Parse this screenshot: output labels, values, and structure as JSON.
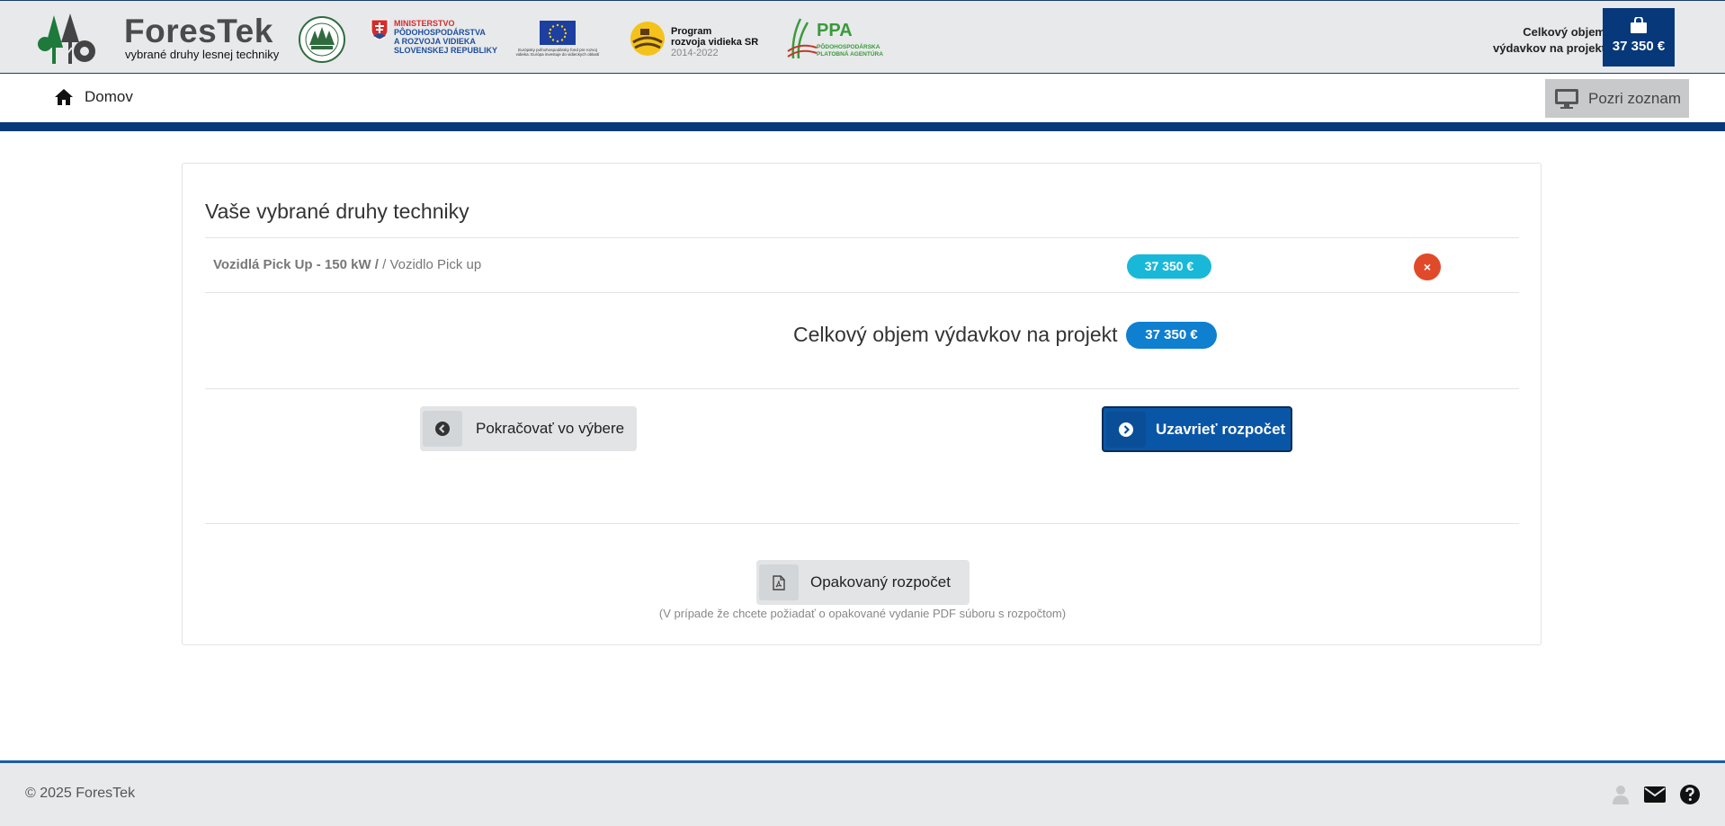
{
  "header": {
    "brand": "ForesTek",
    "tagline": "vybrané druhy lesnej techniky",
    "ministry_logo_text": [
      "MINISTERSTVO",
      "PÔDOHOSPODÁRSTVA",
      "A ROZVOJA VIDIEKA",
      "SLOVENSKEJ REPUBLIKY"
    ],
    "eu_logo_text": "Európsky poľnohospodársky fond pre rozvoj vidieka: Európa investuje do vidieckych oblastí",
    "prv_logo_text": [
      "Program",
      "rozvoja vidieka SR",
      "2014-2022"
    ],
    "ppa_logo_text": [
      "PPA",
      "PÔDOHOSPODÁRSKA",
      "PLATOBNÁ AGENTÚRA"
    ],
    "cart_label_line1": "Celkový objem",
    "cart_label_line2": "výdavkov na projekt",
    "cart_total": "37 350 €"
  },
  "nav": {
    "home_label": "Domov",
    "view_list_label": "Pozri zoznam"
  },
  "card": {
    "title": "Vaše vybrané druhy techniky",
    "item": {
      "name_bold": "Vozidlá Pick Up - 150 kW /",
      "name_rest": " / Vozidlo Pick up",
      "price": "37 350 €",
      "remove_symbol": "×"
    },
    "total_label": "Celkový objem výdavkov na projekt",
    "total_price": "37 350 €",
    "continue_label": "Pokračovať vo výbere",
    "close_label": "Uzavrieť rozpočet",
    "repeat_label": "Opakovaný rozpočet",
    "repeat_note": "(V prípade že chcete požiadať o opakované vydanie PDF súboru s rozpočtom)"
  },
  "footer": {
    "copyright": "© 2025 ForesTek"
  },
  "colors": {
    "navy": "#06387a",
    "item_badge": "#1ab8d8",
    "total_badge": "#0f7fd0",
    "remove": "#e04a2b",
    "primary_button": "#0a56a6"
  },
  "icons": [
    "forestek-logo-icon",
    "seal-icon",
    "slovak-crest-icon",
    "eu-flag-icon",
    "prv-logo-icon",
    "ppa-logo-icon",
    "shopping-bag-icon",
    "home-icon",
    "monitor-icon",
    "remove-icon",
    "arrow-circle-left-icon",
    "arrow-circle-right-icon",
    "file-pdf-icon",
    "user-icon",
    "envelope-icon",
    "question-circle-icon"
  ]
}
